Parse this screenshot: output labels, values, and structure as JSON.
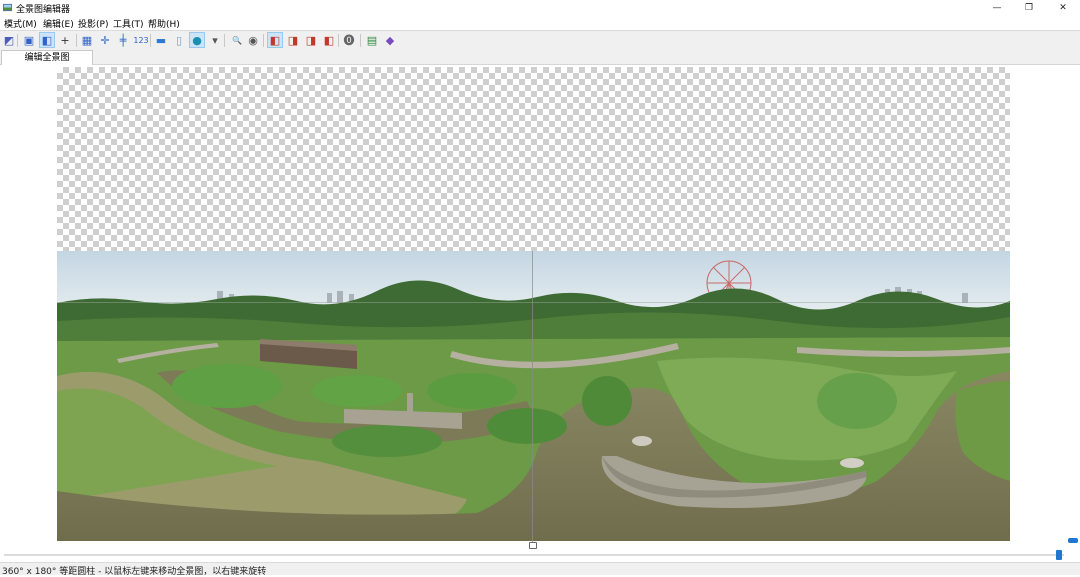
{
  "window": {
    "title": "全景图编辑器",
    "controls": {
      "minimize": "—",
      "maximize": "❐",
      "close": "✕"
    }
  },
  "menu": {
    "items": [
      "模式(M)",
      "编辑(E)",
      "投影(P)",
      "工具(T)",
      "帮助(H)"
    ]
  },
  "toolbar": {
    "buttons": [
      {
        "name": "select-tool-icon",
        "color": "#4a5db8",
        "glyph": "◩",
        "active": false
      },
      {
        "name": "image-stack-icon",
        "color": "#2f63c9",
        "glyph": "▣",
        "active": false
      },
      {
        "name": "move-tool-icon",
        "color": "#2f63c9",
        "glyph": "◧",
        "active": true
      },
      {
        "name": "crosshair-icon",
        "color": "#333333",
        "glyph": "+",
        "active": false
      },
      {
        "name": "grid-icon",
        "color": "#2f63c9",
        "glyph": "▦",
        "active": false
      },
      {
        "name": "control-points-icon",
        "color": "#2f63c9",
        "glyph": "✛",
        "active": false
      },
      {
        "name": "align-icon",
        "color": "#2f63c9",
        "glyph": "╪",
        "active": false
      },
      {
        "name": "numbering-label",
        "color": "#2f63c9",
        "glyph": "123",
        "active": false
      },
      {
        "name": "flat-projection-icon",
        "color": "#2f7ad1",
        "glyph": "▬",
        "active": false
      },
      {
        "name": "cylinder-projection-icon",
        "color": "#6fa0c8",
        "glyph": "▯",
        "active": false
      },
      {
        "name": "sphere-projection-icon",
        "color": "#1c8fb0",
        "glyph": "●",
        "active": true
      },
      {
        "name": "dropdown-arrow-icon",
        "color": "#555555",
        "glyph": "▾",
        "active": false
      },
      {
        "name": "zoom-icon",
        "color": "#d08a1a",
        "glyph": "🔍",
        "active": false
      },
      {
        "name": "preview-eye-icon",
        "color": "#555555",
        "glyph": "◉",
        "active": false
      },
      {
        "name": "view-front-icon",
        "color": "#c0392b",
        "glyph": "◧",
        "active": true
      },
      {
        "name": "view-left-icon",
        "color": "#c0392b",
        "glyph": "◨",
        "active": false
      },
      {
        "name": "view-right-icon",
        "color": "#c0392b",
        "glyph": "◨",
        "active": false
      },
      {
        "name": "view-back-icon",
        "color": "#c0392b",
        "glyph": "◧",
        "active": false
      },
      {
        "name": "info-icon",
        "color": "#666666",
        "glyph": "⓿",
        "active": false
      },
      {
        "name": "window-layout-icon",
        "color": "#2e8b3a",
        "glyph": "▤",
        "active": false
      },
      {
        "name": "book-icon",
        "color": "#7a4bbf",
        "glyph": "◆",
        "active": false
      }
    ]
  },
  "tabs": [
    {
      "label": "编辑全景图"
    }
  ],
  "status": {
    "text": "360° x 180° 等距圆柱 - 以鼠标左键来移动全景图，以右键来旋转"
  },
  "view": {
    "zoom_slider": {
      "position_fraction": 0.995
    }
  },
  "colors": {
    "accent": "#1e78d2",
    "sky": "#c9dbe6",
    "water": "#7b7a58",
    "grass": "#5e8f3c"
  }
}
